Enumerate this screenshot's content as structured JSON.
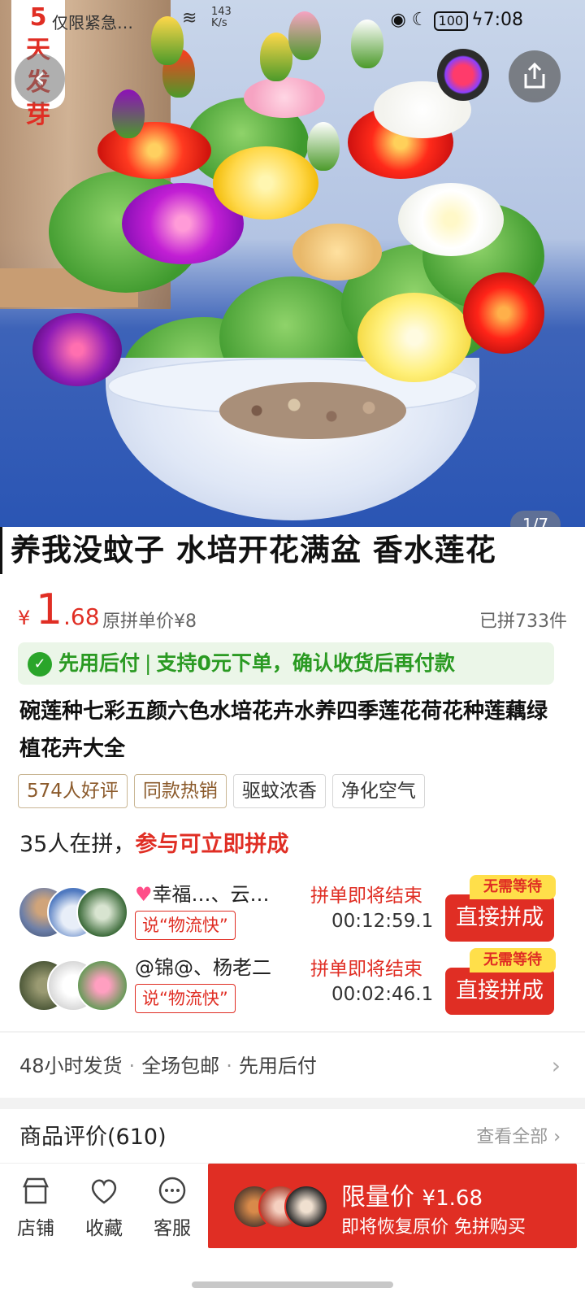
{
  "status_bar": {
    "notification": "仅限紧急…",
    "net_speed": "143 K/s",
    "battery": "100",
    "time": "7:08"
  },
  "hero": {
    "badge": "5天发芽",
    "counter": "1/7",
    "back_icon": "back-icon",
    "share_icon": "share-icon"
  },
  "banner": {
    "text": "养我没蚊子 水培开花满盆 香水莲花"
  },
  "price": {
    "currency": "¥",
    "integer": "1",
    "decimal": ".68",
    "original": "原拼单价¥8",
    "sold": "已拼733件"
  },
  "paylater": {
    "label": "先用后付",
    "text": "支持0元下单，确认收货后再付款"
  },
  "description": "碗莲种七彩五颜六色水培花卉水养四季莲花荷花种莲藕绿植花卉大全",
  "tags": [
    "574人好评",
    "同款热销",
    "驱蚊浓香",
    "净化空气"
  ],
  "group": {
    "count_text": "35人在拼，",
    "highlight": "参与可立即拼成",
    "items": [
      {
        "names": "幸福…、云…",
        "quote": "说“物流快”",
        "ending": "拼单即将结束",
        "time": "00:12:59.1",
        "no_wait": "无需等待",
        "button": "直接拼成"
      },
      {
        "names": "@锦@、杨老二",
        "quote": "说“物流快”",
        "ending": "拼单即将结束",
        "time": "00:02:46.1",
        "no_wait": "无需等待",
        "button": "直接拼成"
      }
    ]
  },
  "shipping": {
    "items": [
      "48小时发货",
      "全场包邮",
      "先用后付"
    ]
  },
  "reviews": {
    "title": "商品评价(610)",
    "view_all": "查看全部"
  },
  "bottom_bar": {
    "store": "店铺",
    "favorite": "收藏",
    "service": "客服",
    "buy_line1": "限量价",
    "buy_price": "¥1.68",
    "buy_line2": "即将恢复原价 免拼购买"
  },
  "colors": {
    "accent": "#e02e24",
    "green": "#2a9a22",
    "tag_brown": "#8b5a2b"
  }
}
